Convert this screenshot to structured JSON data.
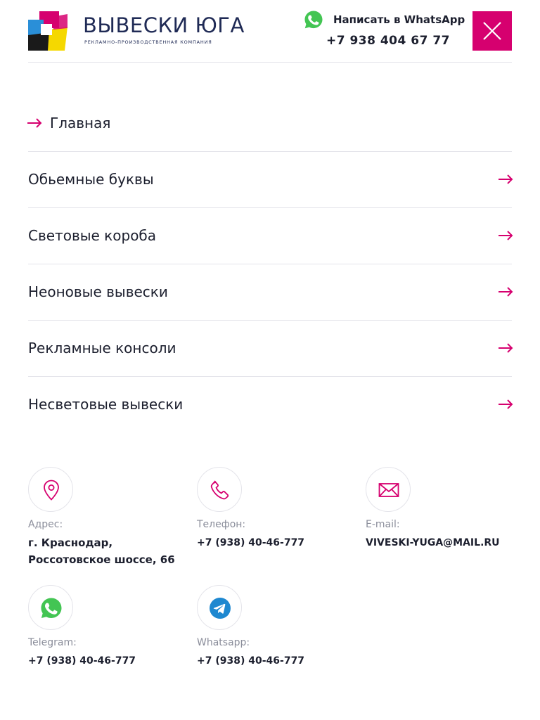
{
  "header": {
    "logo_title": "ВЫВЕСКИ ЮГА",
    "logo_subtitle": "РЕКЛАМНО-ПРОИЗВОДСТВЕННАЯ КОМПАНИЯ",
    "whatsapp_label": "Написать в WhatsApp",
    "phone": "+7 938 404 67 77",
    "close_icon": "close-icon"
  },
  "menu": {
    "items": [
      {
        "label": "Главная",
        "icon": "arrow-left-icon"
      },
      {
        "label": "Обьемные буквы",
        "icon": "arrow-right-icon"
      },
      {
        "label": "Световые короба",
        "icon": "arrow-right-icon"
      },
      {
        "label": "Неоновые вывески",
        "icon": "arrow-right-icon"
      },
      {
        "label": "Рекламные консоли",
        "icon": "arrow-right-icon"
      },
      {
        "label": "Несветовые вывески",
        "icon": "arrow-right-icon"
      }
    ]
  },
  "contacts": {
    "address": {
      "label": "Адрес:",
      "value": "г. Краснодар, Россотовское шоссе, 66"
    },
    "phone": {
      "label": "Телефон:",
      "value": "+7 (938) 40-46-777"
    },
    "email": {
      "label": "E-mail:",
      "value": "VIVESKI-YUGA@MAIL.RU"
    },
    "telegram": {
      "label": "Telegram:",
      "value": "+7 (938) 40-46-777"
    },
    "whatsapp": {
      "label": "Whatsapp:",
      "value": "+7 (938) 40-46-777"
    }
  },
  "colors": {
    "accent": "#d6006f",
    "text": "#1c1f2e",
    "muted": "#8a8d9a",
    "divider": "#e4e4ea",
    "whatsapp_green": "#43c553",
    "telegram_blue": "#1e88d0"
  }
}
